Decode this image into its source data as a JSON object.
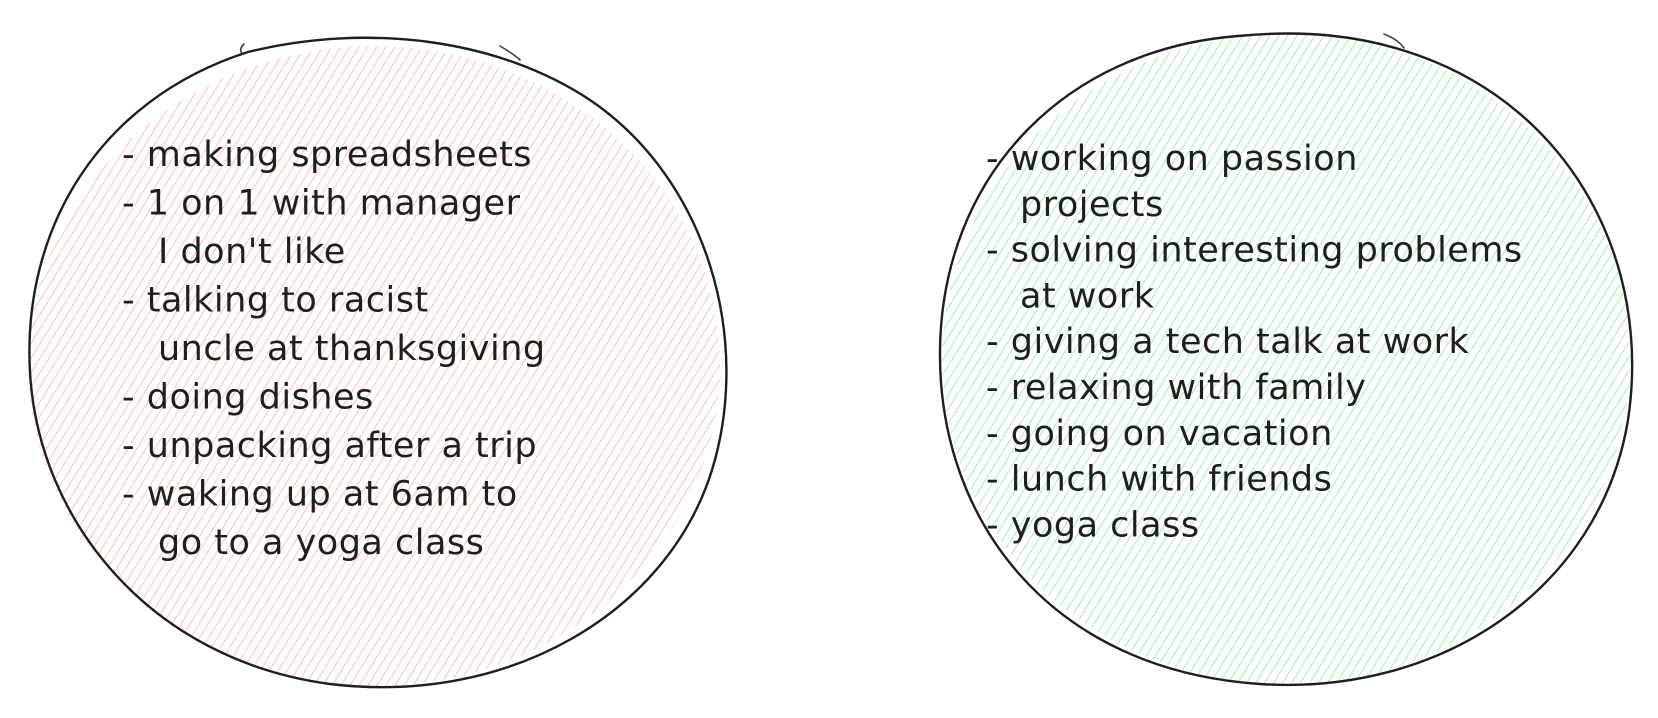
{
  "colors": {
    "ink": "#1e1e1e",
    "left_fill": "#ffc9c9",
    "right_fill": "#b2f2bb"
  },
  "left_circle": {
    "items": [
      {
        "lines": [
          "- making spreadsheets"
        ]
      },
      {
        "lines": [
          "- 1 on 1 with manager",
          "I don't like"
        ]
      },
      {
        "lines": [
          "- talking to racist",
          "uncle at thanksgiving"
        ]
      },
      {
        "lines": [
          "- doing dishes"
        ]
      },
      {
        "lines": [
          "- unpacking after a trip"
        ]
      },
      {
        "lines": [
          "- waking up at 6am to",
          "go to a yoga class"
        ]
      }
    ]
  },
  "right_circle": {
    "items": [
      {
        "lines": [
          "- working on passion",
          "projects"
        ]
      },
      {
        "lines": [
          "- solving interesting problems",
          "at work"
        ]
      },
      {
        "lines": [
          "- giving a tech talk at work"
        ]
      },
      {
        "lines": [
          "- relaxing with family"
        ]
      },
      {
        "lines": [
          "- going on vacation"
        ]
      },
      {
        "lines": [
          "- lunch with friends"
        ]
      },
      {
        "lines": [
          "- yoga class"
        ]
      }
    ]
  }
}
